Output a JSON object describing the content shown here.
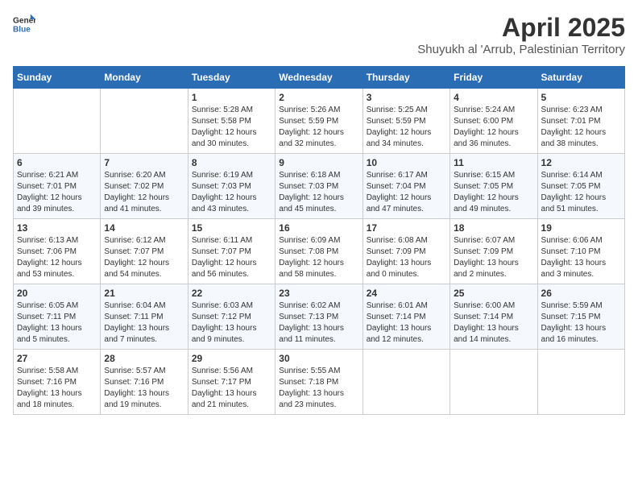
{
  "logo": {
    "general": "General",
    "blue": "Blue"
  },
  "title": "April 2025",
  "subtitle": "Shuyukh al 'Arrub, Palestinian Territory",
  "days_header": [
    "Sunday",
    "Monday",
    "Tuesday",
    "Wednesday",
    "Thursday",
    "Friday",
    "Saturday"
  ],
  "weeks": [
    [
      {
        "day": "",
        "info": ""
      },
      {
        "day": "",
        "info": ""
      },
      {
        "day": "1",
        "info": "Sunrise: 5:28 AM\nSunset: 5:58 PM\nDaylight: 12 hours\nand 30 minutes."
      },
      {
        "day": "2",
        "info": "Sunrise: 5:26 AM\nSunset: 5:59 PM\nDaylight: 12 hours\nand 32 minutes."
      },
      {
        "day": "3",
        "info": "Sunrise: 5:25 AM\nSunset: 5:59 PM\nDaylight: 12 hours\nand 34 minutes."
      },
      {
        "day": "4",
        "info": "Sunrise: 5:24 AM\nSunset: 6:00 PM\nDaylight: 12 hours\nand 36 minutes."
      },
      {
        "day": "5",
        "info": "Sunrise: 6:23 AM\nSunset: 7:01 PM\nDaylight: 12 hours\nand 38 minutes."
      }
    ],
    [
      {
        "day": "6",
        "info": "Sunrise: 6:21 AM\nSunset: 7:01 PM\nDaylight: 12 hours\nand 39 minutes."
      },
      {
        "day": "7",
        "info": "Sunrise: 6:20 AM\nSunset: 7:02 PM\nDaylight: 12 hours\nand 41 minutes."
      },
      {
        "day": "8",
        "info": "Sunrise: 6:19 AM\nSunset: 7:03 PM\nDaylight: 12 hours\nand 43 minutes."
      },
      {
        "day": "9",
        "info": "Sunrise: 6:18 AM\nSunset: 7:03 PM\nDaylight: 12 hours\nand 45 minutes."
      },
      {
        "day": "10",
        "info": "Sunrise: 6:17 AM\nSunset: 7:04 PM\nDaylight: 12 hours\nand 47 minutes."
      },
      {
        "day": "11",
        "info": "Sunrise: 6:15 AM\nSunset: 7:05 PM\nDaylight: 12 hours\nand 49 minutes."
      },
      {
        "day": "12",
        "info": "Sunrise: 6:14 AM\nSunset: 7:05 PM\nDaylight: 12 hours\nand 51 minutes."
      }
    ],
    [
      {
        "day": "13",
        "info": "Sunrise: 6:13 AM\nSunset: 7:06 PM\nDaylight: 12 hours\nand 53 minutes."
      },
      {
        "day": "14",
        "info": "Sunrise: 6:12 AM\nSunset: 7:07 PM\nDaylight: 12 hours\nand 54 minutes."
      },
      {
        "day": "15",
        "info": "Sunrise: 6:11 AM\nSunset: 7:07 PM\nDaylight: 12 hours\nand 56 minutes."
      },
      {
        "day": "16",
        "info": "Sunrise: 6:09 AM\nSunset: 7:08 PM\nDaylight: 12 hours\nand 58 minutes."
      },
      {
        "day": "17",
        "info": "Sunrise: 6:08 AM\nSunset: 7:09 PM\nDaylight: 13 hours\nand 0 minutes."
      },
      {
        "day": "18",
        "info": "Sunrise: 6:07 AM\nSunset: 7:09 PM\nDaylight: 13 hours\nand 2 minutes."
      },
      {
        "day": "19",
        "info": "Sunrise: 6:06 AM\nSunset: 7:10 PM\nDaylight: 13 hours\nand 3 minutes."
      }
    ],
    [
      {
        "day": "20",
        "info": "Sunrise: 6:05 AM\nSunset: 7:11 PM\nDaylight: 13 hours\nand 5 minutes."
      },
      {
        "day": "21",
        "info": "Sunrise: 6:04 AM\nSunset: 7:11 PM\nDaylight: 13 hours\nand 7 minutes."
      },
      {
        "day": "22",
        "info": "Sunrise: 6:03 AM\nSunset: 7:12 PM\nDaylight: 13 hours\nand 9 minutes."
      },
      {
        "day": "23",
        "info": "Sunrise: 6:02 AM\nSunset: 7:13 PM\nDaylight: 13 hours\nand 11 minutes."
      },
      {
        "day": "24",
        "info": "Sunrise: 6:01 AM\nSunset: 7:14 PM\nDaylight: 13 hours\nand 12 minutes."
      },
      {
        "day": "25",
        "info": "Sunrise: 6:00 AM\nSunset: 7:14 PM\nDaylight: 13 hours\nand 14 minutes."
      },
      {
        "day": "26",
        "info": "Sunrise: 5:59 AM\nSunset: 7:15 PM\nDaylight: 13 hours\nand 16 minutes."
      }
    ],
    [
      {
        "day": "27",
        "info": "Sunrise: 5:58 AM\nSunset: 7:16 PM\nDaylight: 13 hours\nand 18 minutes."
      },
      {
        "day": "28",
        "info": "Sunrise: 5:57 AM\nSunset: 7:16 PM\nDaylight: 13 hours\nand 19 minutes."
      },
      {
        "day": "29",
        "info": "Sunrise: 5:56 AM\nSunset: 7:17 PM\nDaylight: 13 hours\nand 21 minutes."
      },
      {
        "day": "30",
        "info": "Sunrise: 5:55 AM\nSunset: 7:18 PM\nDaylight: 13 hours\nand 23 minutes."
      },
      {
        "day": "",
        "info": ""
      },
      {
        "day": "",
        "info": ""
      },
      {
        "day": "",
        "info": ""
      }
    ]
  ]
}
